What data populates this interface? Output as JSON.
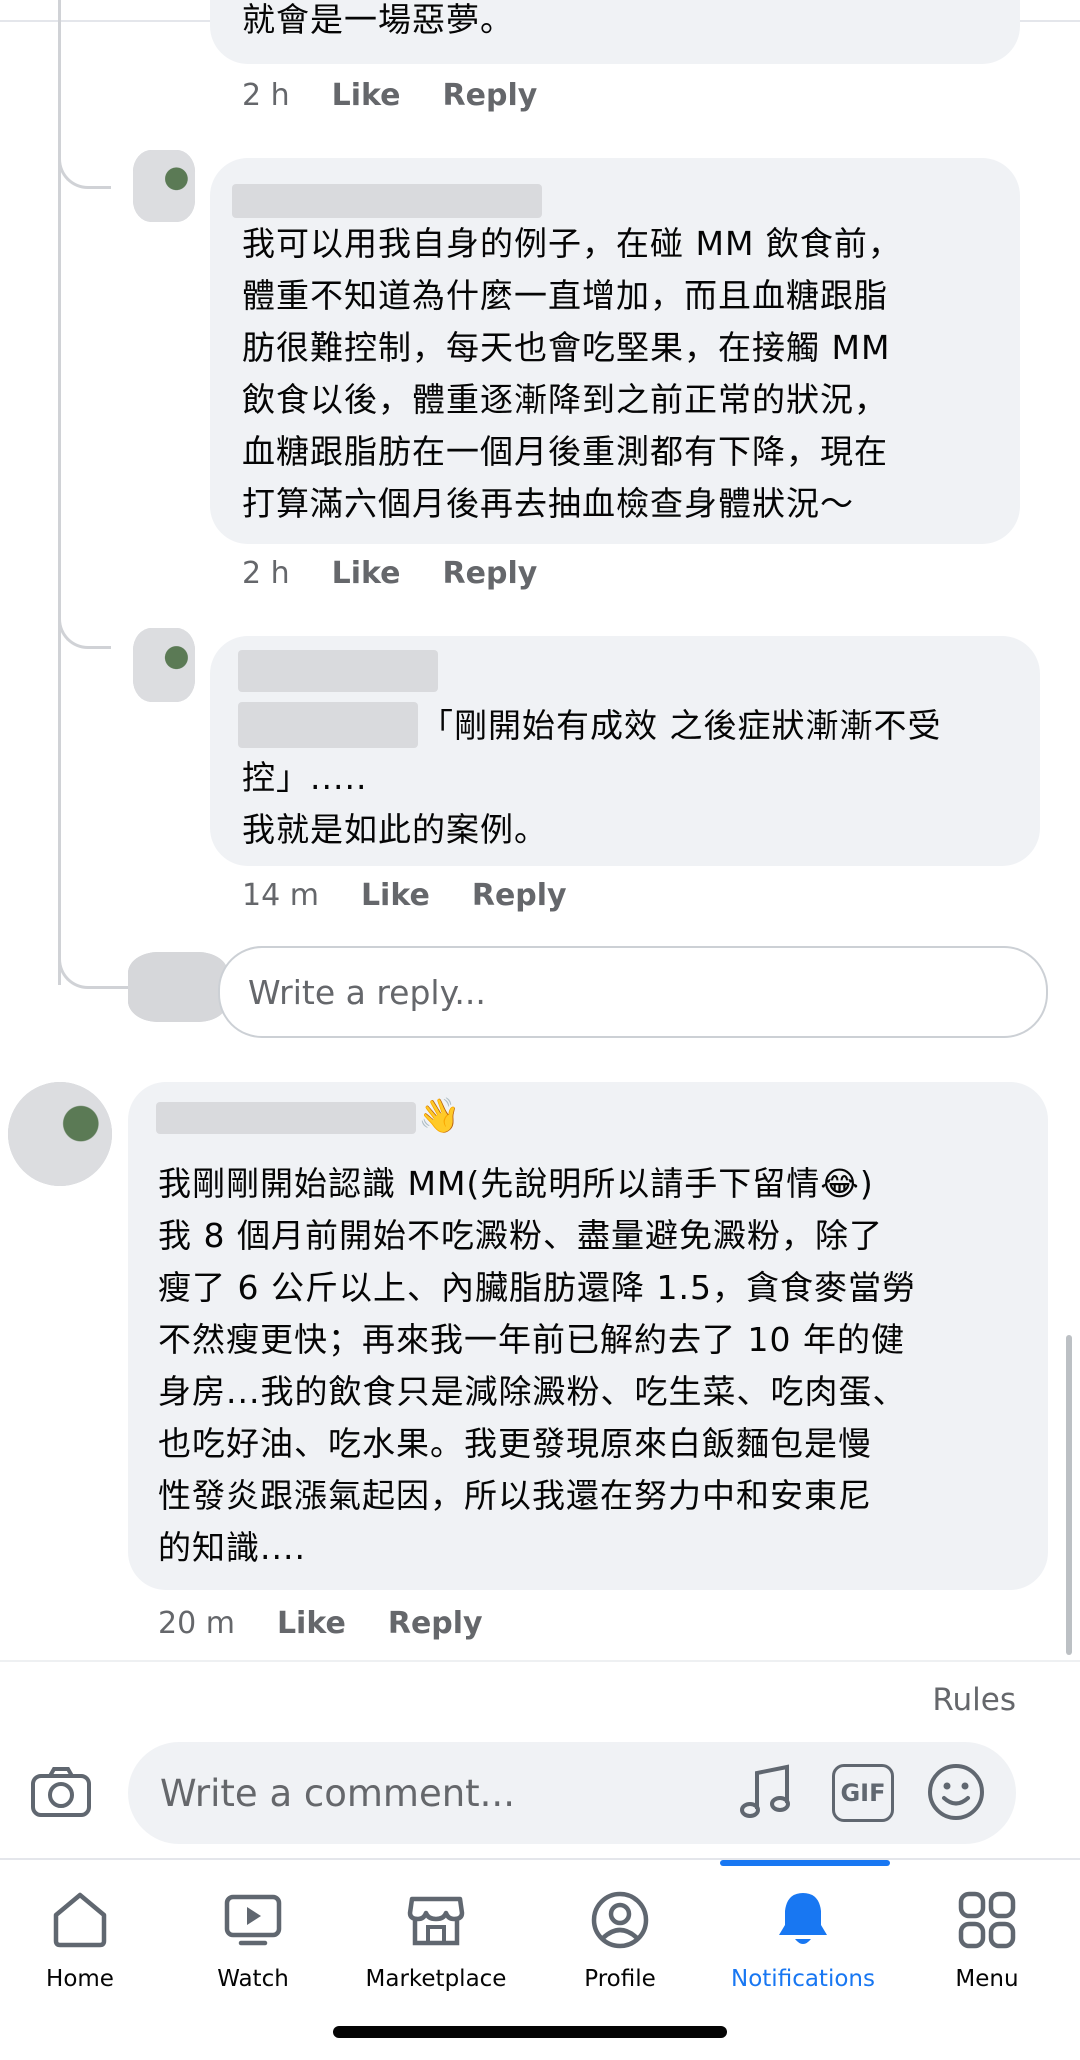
{
  "comments": [
    {
      "text_partial": "就會是一場惡夢。",
      "time": "2 h",
      "like": "Like",
      "reply": "Reply"
    },
    {
      "text": "我可以用我自身的例子，在碰 MM 飲食前，\n體重不知道為什麼一直增加，而且血糖跟脂\n肪很難控制，每天也會吃堅果，在接觸 MM\n飲食以後，體重逐漸降到之前正常的狀況，\n血糖跟脂肪在一個月後重測都有下降，現在\n打算滿六個月後再去抽血檢查身體狀況～",
      "time": "2 h",
      "like": "Like",
      "reply": "Reply"
    },
    {
      "text_line1": "「剛開始有成效 之後症狀漸漸不受",
      "text_rest": "控」.....\n我就是如此的案例。",
      "time": "14 m",
      "like": "Like",
      "reply": "Reply"
    },
    {
      "text": "我剛剛開始認識 MM(先說明所以請手下留情😂)\n我 8 個月前開始不吃澱粉、盡量避免澱粉，除了\n瘦了 6 公斤以上、內臟脂肪還降 1.5，貪食麥當勞\n不然瘦更快；再來我一年前已解約去了 10 年的健\n身房...我的飲食只是減除澱粉、吃生菜、吃肉蛋、\n也吃好油、吃水果。我更發現原來白飯麵包是慢\n性發炎跟漲氣起因，所以我還在努力中和安東尼\n的知識....",
      "time": "20 m",
      "like": "Like",
      "reply": "Reply"
    }
  ],
  "reply_input": {
    "placeholder": "Write a reply..."
  },
  "rules_link": "Rules",
  "composer": {
    "placeholder": "Write a comment..."
  },
  "tabs": [
    {
      "label": "Home",
      "icon": "home-icon"
    },
    {
      "label": "Watch",
      "icon": "watch-icon"
    },
    {
      "label": "Marketplace",
      "icon": "marketplace-icon"
    },
    {
      "label": "Profile",
      "icon": "profile-icon"
    },
    {
      "label": "Notifications",
      "icon": "bell-icon",
      "active": true
    },
    {
      "label": "Menu",
      "icon": "menu-grid-icon"
    }
  ],
  "colors": {
    "accent": "#1877f2",
    "bubble": "#f0f2f5",
    "meta": "#65676b"
  }
}
